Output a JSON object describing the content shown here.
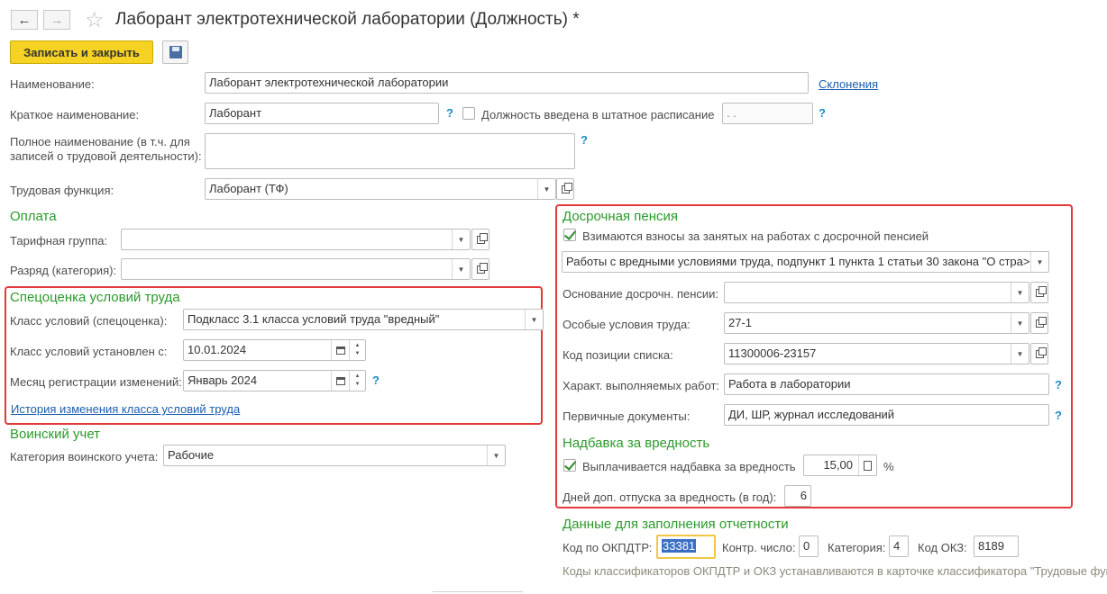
{
  "window": {
    "title": "Лаборант электротехнической лаборатории (Должность) *"
  },
  "toolbar": {
    "save_close_label": "Записать и закрыть"
  },
  "main": {
    "name_label": "Наименование:",
    "name_value": "Лаборант электротехнической лаборатории",
    "declensions_link": "Склонения",
    "short_name_label": "Краткое наименование:",
    "short_name_value": "Лаборант",
    "staff_checkbox_label": "Должность введена в штатное расписание",
    "staff_date_value": " .  .",
    "full_name_label_line1": "Полное наименование (в т.ч. для",
    "full_name_label_line2": "записей о трудовой деятельности):",
    "full_name_value": "",
    "labor_function_label": "Трудовая функция:",
    "labor_function_value": "Лаборант (ТФ)",
    "help_mark": "?"
  },
  "payment": {
    "title": "Оплата",
    "tariff_group_label": "Тарифная группа:",
    "tariff_group_value": "",
    "grade_label": "Разряд (категория):",
    "grade_value": ""
  },
  "special_assessment": {
    "title": "Спецоценка условий труда",
    "class_label": "Класс условий (спецоценка):",
    "class_value": "Подкласс 3.1 класса условий труда \"вредный\"",
    "established_label": "Класс условий установлен с:",
    "established_value": "10.01.2024",
    "month_label": "Месяц регистрации изменений:",
    "month_value": "Январь 2024",
    "history_link": "История изменения класса условий труда"
  },
  "military": {
    "title": "Воинский учет",
    "category_label": "Категория воинского учета:",
    "category_value": "Рабочие"
  },
  "early_pension": {
    "title": "Досрочная пенсия",
    "contributions_checkbox_label": "Взимаются взносы за занятых на работах с досрочной пенсией",
    "contributions_checked": true,
    "work_type_value": "Работы с вредными условиями труда, подпункт 1 пункта 1 статьи 30 закона \"О стра>",
    "basis_label": "Основание досрочн. пенсии:",
    "basis_value": "",
    "special_conditions_label": "Особые условия труда:",
    "special_conditions_value": "27-1",
    "position_code_label": "Код позиции списка:",
    "position_code_value": "11300006-23157",
    "work_character_label": "Характ. выполняемых работ:",
    "work_character_value": "Работа в лаборатории",
    "primary_docs_label": "Первичные документы:",
    "primary_docs_value": "ДИ, ШР, журнал исследований"
  },
  "hazard_bonus": {
    "title": "Надбавка за вредность",
    "paid_checkbox_label": "Выплачивается надбавка за вредность",
    "paid_checked": true,
    "percent_value": "15,00",
    "percent_sign": "%",
    "extra_leave_label": "Дней доп. отпуска за вредность (в год):",
    "extra_leave_value": "6"
  },
  "reporting": {
    "title": "Данные для заполнения отчетности",
    "okpdtr_label": "Код по ОКПДТР:",
    "okpdtr_value": "33381",
    "check_number_label": "Контр. число:",
    "check_number_value": "0",
    "category_label": "Категория:",
    "category_value": "4",
    "okz_label": "Код ОКЗ:",
    "okz_value": "8189",
    "note": "Коды классификаторов ОКПДТР и ОКЗ устанавливаются в карточке классификатора \"Трудовые фун"
  },
  "colors": {
    "section_green": "#2a9a2a",
    "highlight_red": "#e23a3a",
    "primary_button": "#f5d224",
    "link_blue": "#1a5dad"
  }
}
